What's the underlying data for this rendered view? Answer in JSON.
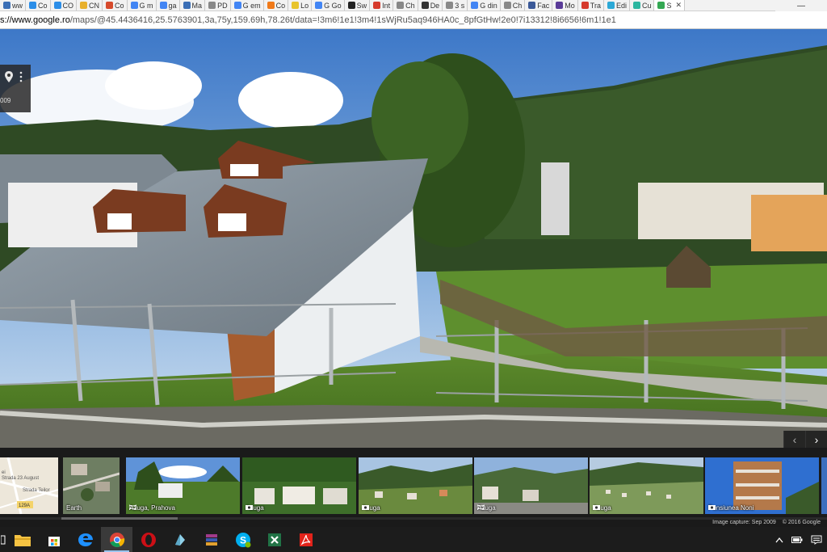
{
  "browser": {
    "tabs": [
      {
        "title": "ww",
        "color": "#3b6fb6"
      },
      {
        "title": "Co",
        "color": "#2c8ee8"
      },
      {
        "title": "CO",
        "color": "#2c8ee8"
      },
      {
        "title": "CN",
        "color": "#e8b02c"
      },
      {
        "title": "Co",
        "color": "#d64a2c"
      },
      {
        "title": "G m",
        "color": "#4285f4"
      },
      {
        "title": "ga",
        "color": "#4285f4"
      },
      {
        "title": "Ma",
        "color": "#3b6fb6"
      },
      {
        "title": "PD",
        "color": "#888888"
      },
      {
        "title": "G em",
        "color": "#4285f4"
      },
      {
        "title": "Co",
        "color": "#f07a1a"
      },
      {
        "title": "Lo",
        "color": "#e8c42c"
      },
      {
        "title": "G Go",
        "color": "#4285f4"
      },
      {
        "title": "Sw",
        "color": "#222222"
      },
      {
        "title": "Int",
        "color": "#d63a2c"
      },
      {
        "title": "Ch",
        "color": "#888888"
      },
      {
        "title": "De",
        "color": "#333333"
      },
      {
        "title": "3 s",
        "color": "#888888"
      },
      {
        "title": "G din",
        "color": "#4285f4"
      },
      {
        "title": "Ch",
        "color": "#888888"
      },
      {
        "title": "Fac",
        "color": "#3b5998"
      },
      {
        "title": "Mo",
        "color": "#5a3b98"
      },
      {
        "title": "Tra",
        "color": "#d63a2c"
      },
      {
        "title": "Edi",
        "color": "#2ca8d6"
      },
      {
        "title": "Cu",
        "color": "#2cb6a0"
      },
      {
        "title": "S",
        "color": "#34a853"
      }
    ],
    "window_controls": {
      "minimize": "—"
    },
    "url_host": "s://www.google.ro",
    "url_rest": "/maps/@45.4436416,25.5763901,3a,75y,159.69h,78.26t/data=!3m6!1e1!3m4!1sWjRu5aq946HA0c_8pfGtHw!2e0!7i13312!8i6656!6m1!1e1"
  },
  "streetview": {
    "card_date": "009",
    "pin_icon": "map-pin-icon",
    "menu_icon": "more-vert-icon"
  },
  "filmstrip": {
    "nav_prev": "‹",
    "nav_next": "›",
    "thumbs": [
      {
        "label": "",
        "kind": "map",
        "map_texts": [
          "ei",
          "Strada 23 August",
          "Strada Teilor",
          "129A"
        ]
      },
      {
        "label": "Earth",
        "kind": "earth"
      },
      {
        "label": "Azuga, Prahova",
        "kind": "sv"
      },
      {
        "label": "Azuga",
        "kind": "photo"
      },
      {
        "label": "Azuga",
        "kind": "photo"
      },
      {
        "label": "Azuga",
        "kind": "sv"
      },
      {
        "label": "Azuga",
        "kind": "photo"
      },
      {
        "label": "Pensiunea Noni",
        "kind": "photo"
      }
    ],
    "image_capture": "Image capture: Sep 2009",
    "copyright": "© 2016 Google"
  },
  "taskbar": {
    "items": [
      "task-view-icon",
      "file-explorer-icon",
      "store-icon",
      "edge-icon",
      "chrome-icon",
      "opera-icon",
      "app-icon",
      "winrar-icon",
      "skype-icon",
      "excel-icon",
      "acrobat-icon"
    ],
    "active": "chrome-icon",
    "colors": {
      "chrome": "#4285f4",
      "opera": "#cc0f16",
      "skype": "#00aff0",
      "excel": "#217346",
      "acrobat": "#e2231a",
      "explorer": "#f6c343",
      "edge": "#1e90ff"
    }
  }
}
